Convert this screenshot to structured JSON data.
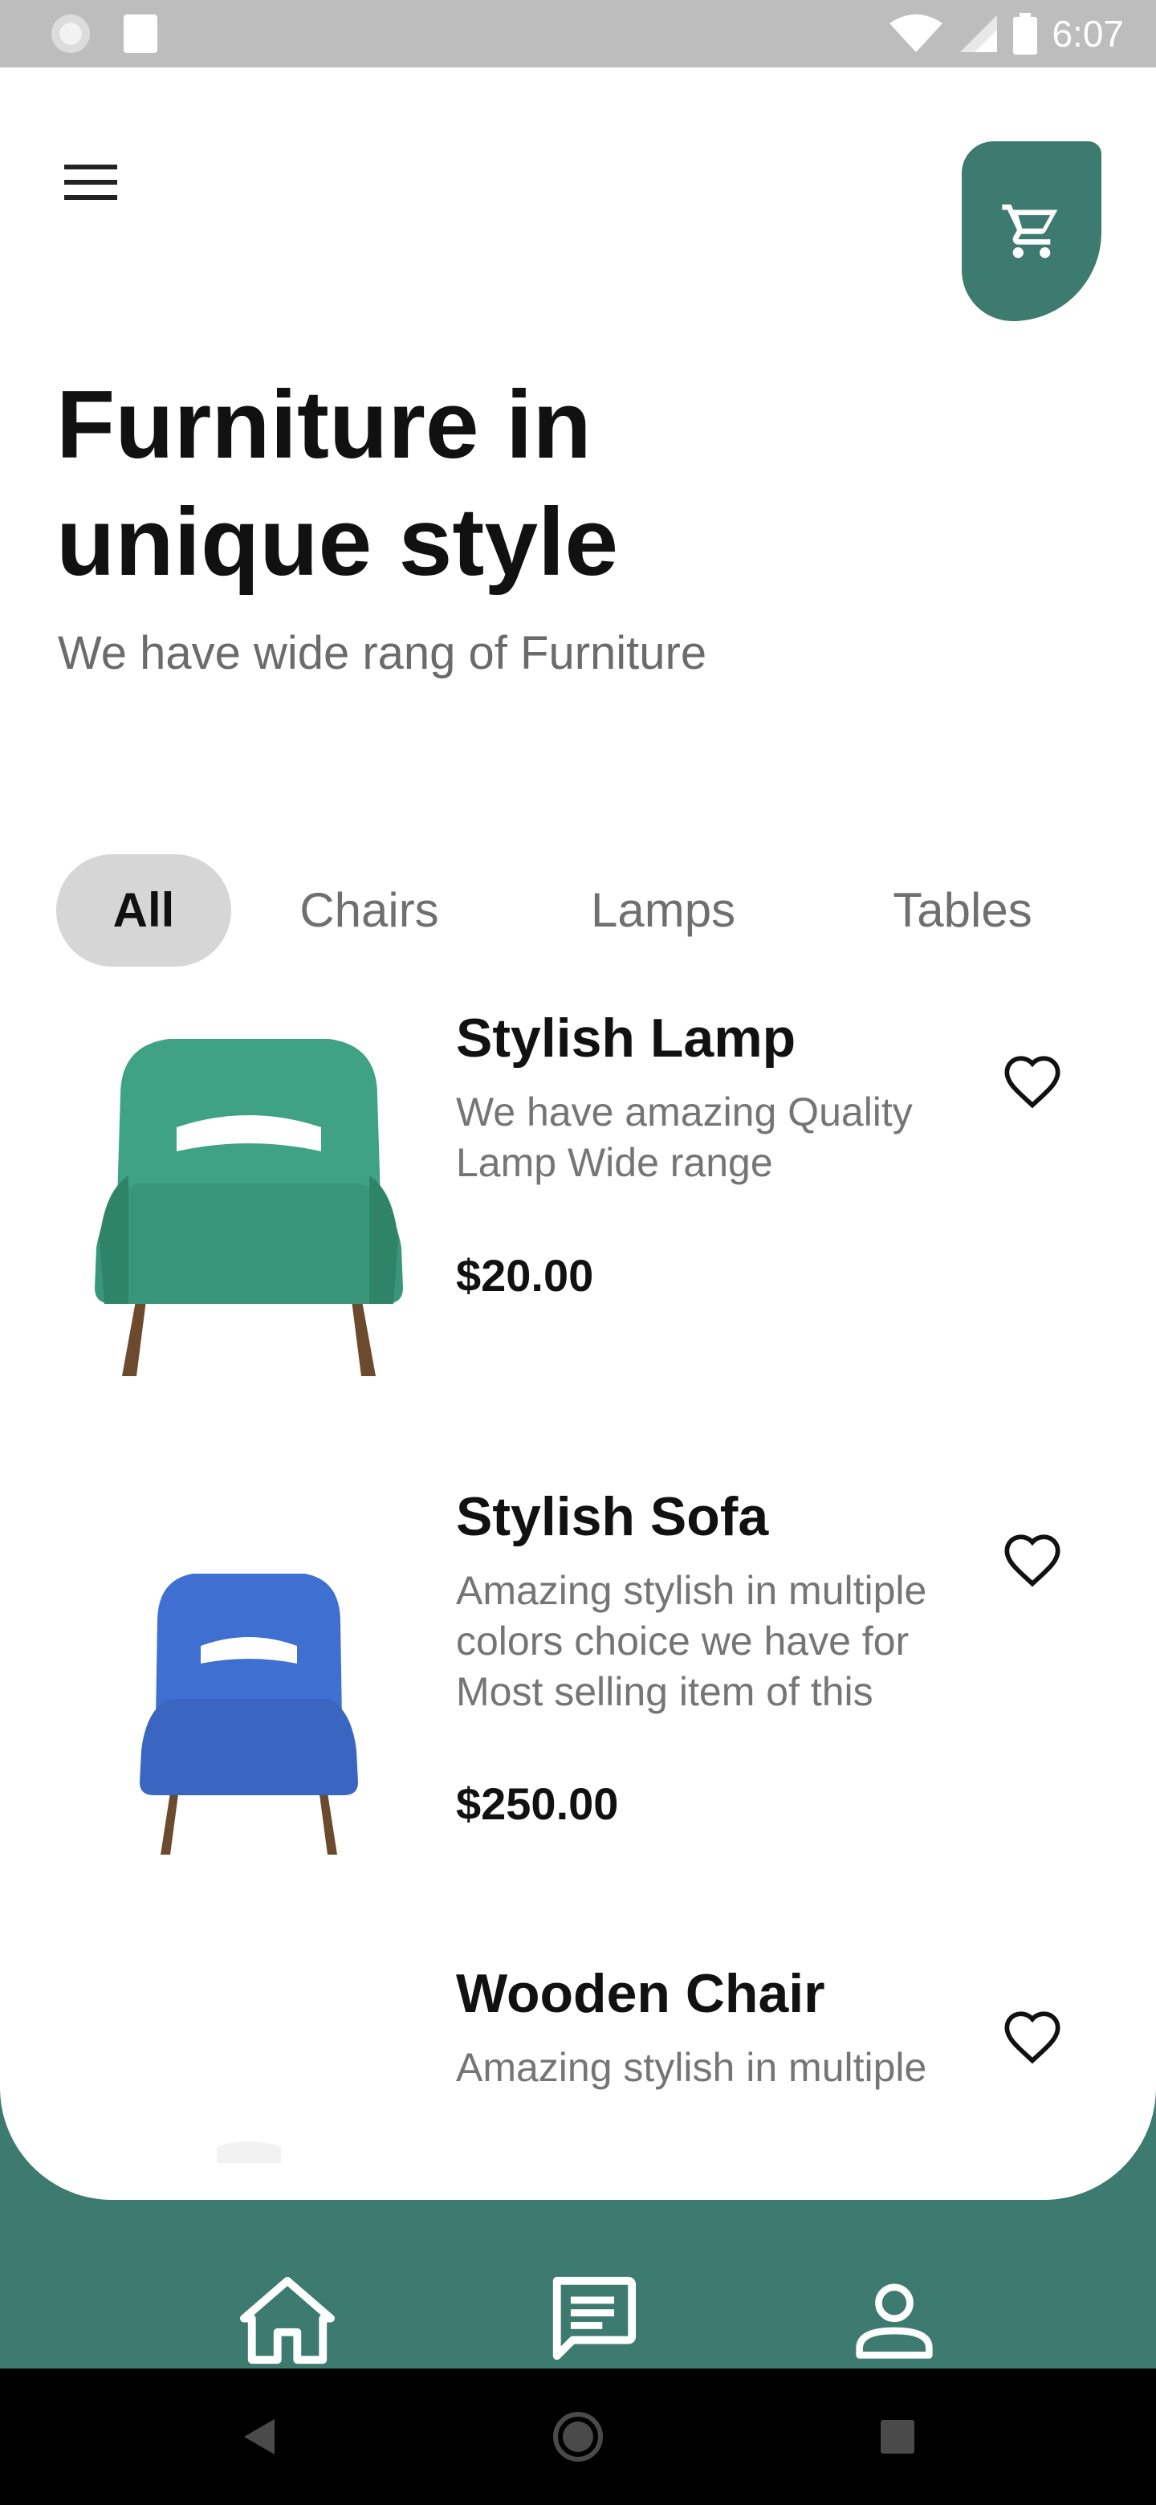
{
  "status_bar": {
    "time": "6:07",
    "icons": [
      "notification-icon",
      "sd-card-icon",
      "wifi-icon",
      "cell-signal-icon",
      "battery-icon"
    ]
  },
  "header": {
    "menu_icon": "menu-icon",
    "cart_icon": "cart-icon",
    "title": "Furniture in unique style",
    "subtitle": "We have wide rang of Furniture"
  },
  "tabs": [
    {
      "label": "All",
      "active": true
    },
    {
      "label": "Chairs",
      "active": false
    },
    {
      "label": "Lamps",
      "active": false
    },
    {
      "label": "Tables",
      "active": false
    }
  ],
  "products": [
    {
      "name": "Stylish Lamp",
      "description": "We have amazing Quality Lamp Wide range",
      "price": "$20.00",
      "image": "green-armchair",
      "color": "#3fa383"
    },
    {
      "name": "Stylish Sofa",
      "description": "Amazing stylish in multiple colors choice we have for Most selling item of this",
      "price": "$250.00",
      "image": "blue-armchair",
      "color": "#3f6fd0"
    },
    {
      "name": "Wooden Chair",
      "description": "Amazing stylish in multiple",
      "price": "",
      "image": "white-chair",
      "color": "#f2f2f2"
    }
  ],
  "bottom_nav": [
    {
      "icon": "home-icon"
    },
    {
      "icon": "message-icon"
    },
    {
      "icon": "profile-icon"
    }
  ],
  "system_nav": [
    "back-icon",
    "home-circle-icon",
    "recents-icon"
  ],
  "colors": {
    "accent": "#3d7b70",
    "tab_active_bg": "#d6d6d6"
  }
}
